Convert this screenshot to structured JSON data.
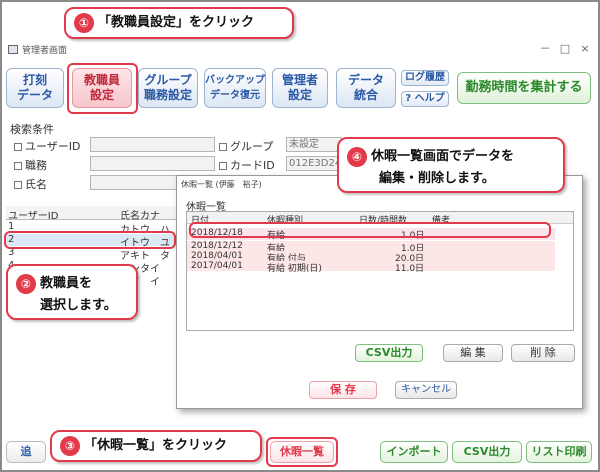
{
  "window": {
    "title": "管理者画面",
    "min": "－",
    "max": "□",
    "close": "×"
  },
  "callouts": {
    "c1": {
      "num": "①",
      "text": "「教職員設定」をクリック"
    },
    "c2": {
      "num": "②",
      "line1": "教職員を",
      "line2": "選択します。"
    },
    "c3": {
      "num": "③",
      "text": "「休暇一覧」をクリック"
    },
    "c4": {
      "num": "④",
      "line1": "休暇一覧画面でデータを",
      "line2": "編集・削除します。"
    }
  },
  "toolbar": {
    "b1": [
      "打刻",
      "データ"
    ],
    "b2": [
      "教職員",
      "設定"
    ],
    "b3": [
      "グループ",
      "職務設定"
    ],
    "b4": [
      "バックアップ",
      "データ復元"
    ],
    "b5": [
      "管理者",
      "設定"
    ],
    "b6": [
      "データ",
      "統合"
    ],
    "log": "ログ履歴",
    "help": "? ヘルプ",
    "aggregate": "勤務時間を集計する"
  },
  "search": {
    "title": "検索条件",
    "user_id": "ユーザーID",
    "group": "グループ",
    "group_value": "未設定",
    "duty": "職務",
    "card_id": "カードID",
    "card_value": "012E3D24",
    "name": "氏名"
  },
  "list": {
    "col_id": "ユーザーID",
    "col_kana": "氏名カナ",
    "rows": [
      {
        "id": "1",
        "kana": "カトウ　ハ"
      },
      {
        "id": "2",
        "kana": "イトウ　ユ"
      },
      {
        "id": "3",
        "kana": "アキト　タ"
      },
      {
        "id": "4",
        "kana": "サンタイ　エ"
      },
      {
        "id": "",
        "kana": "ダイ　イ"
      }
    ]
  },
  "dialog": {
    "title": "休暇一覧 (伊藤　裕子)",
    "group": "休暇一覧",
    "columns": [
      "日付",
      "休暇種別",
      "日数/時間数",
      "備考"
    ],
    "rows": [
      {
        "date": "2018/12/18",
        "type": "有給",
        "amount": "1.0日"
      },
      {
        "date": "2018/12/12",
        "type": "有給",
        "amount": "1.0日"
      },
      {
        "date": "2018/04/01",
        "type": "有給 付与",
        "amount": "20.0日"
      },
      {
        "date": "2017/04/01",
        "type": "有給 初期(日)",
        "amount": "11.0日"
      }
    ],
    "csv": "CSV出力",
    "edit": "編 集",
    "delete": "削 除",
    "save": "保 存",
    "cancel": "キャンセル"
  },
  "bottom": {
    "add": "追",
    "vacation": "休暇一覧",
    "import": "インポート",
    "csv": "CSV出力",
    "print": "リスト印刷"
  },
  "colors": {
    "accent": "#e23a4b",
    "toolbar_text": "#2a5aa5",
    "green": "#2a8a2a"
  }
}
